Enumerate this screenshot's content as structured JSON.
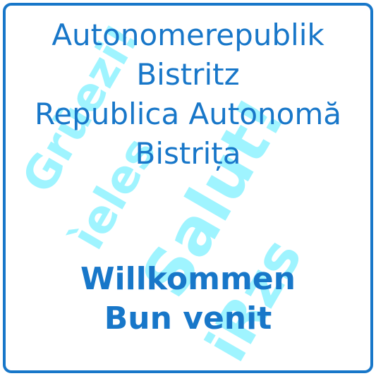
{
  "sign": {
    "official_name_de": [
      "Autonomerepublik",
      "Bistritz"
    ],
    "official_name_ro": [
      "Republica Autonomă",
      "Bistrița"
    ],
    "welcome_de": "Willkommen",
    "welcome_ro": "Bun venit",
    "watermark": [
      "Grüezi!",
      "ìeles",
      "Salut!",
      "iRzs"
    ],
    "colors": {
      "text": "#1877c9",
      "border": "#1877c9",
      "watermark": "#7ff0ff",
      "background": "#ffffff"
    }
  }
}
